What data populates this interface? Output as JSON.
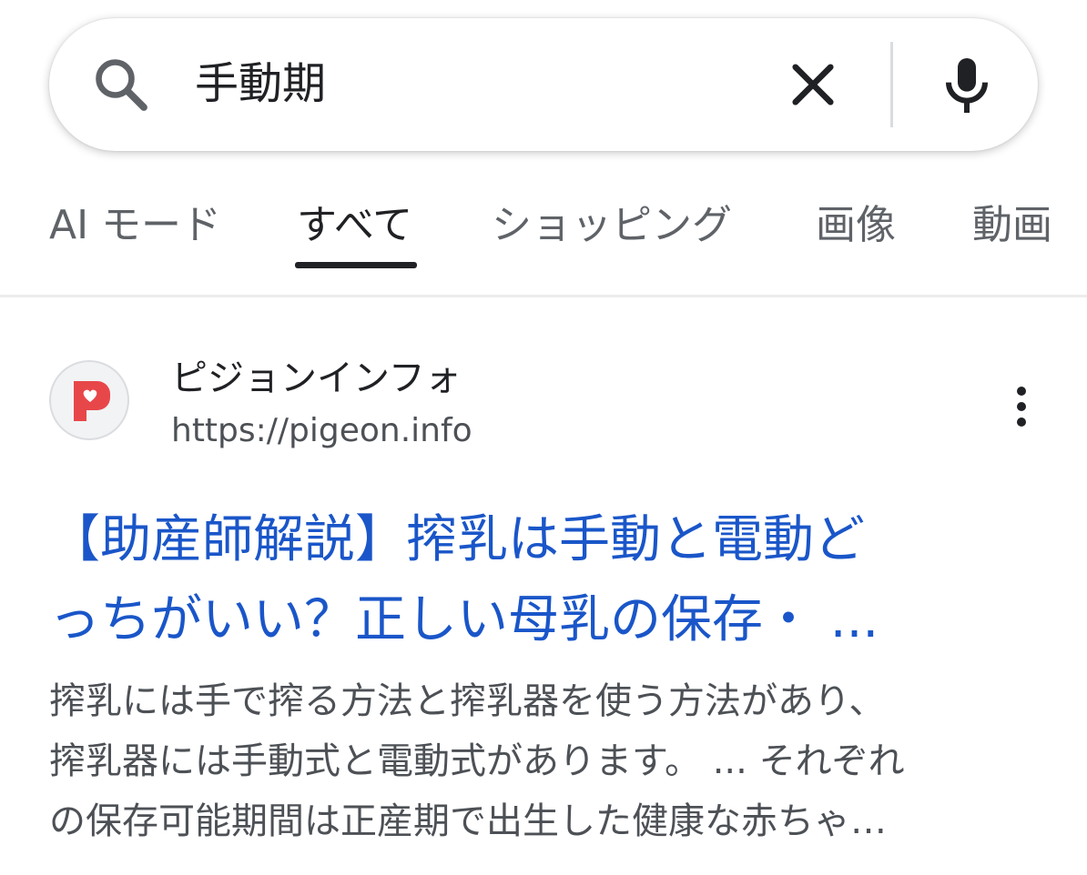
{
  "search": {
    "query": "手動期",
    "icons": {
      "search": "search-icon",
      "clear": "close-icon",
      "voice": "mic-icon"
    }
  },
  "tabs": [
    {
      "label": "AI モード",
      "active": false
    },
    {
      "label": "すべて",
      "active": true
    },
    {
      "label": "ショッピング",
      "active": false
    },
    {
      "label": "画像",
      "active": false
    },
    {
      "label": "動画",
      "active": false
    }
  ],
  "result": {
    "site_name": "ピジョンインフォ",
    "url": "https://pigeon.info",
    "favicon": "pigeon-heart-logo-icon",
    "title_lines": [
      "【助産師解説】搾乳は手動と電動ど",
      "っちがいい？正しい母乳の保存・ ..."
    ],
    "snippet_lines": [
      "搾乳には手で搾る方法と搾乳器を使う方法があり、",
      "搾乳器には手動式と電動式があります。 ... それぞれ",
      "の保存可能期間は正産期で出生した健康な赤ちゃ…"
    ]
  },
  "colors": {
    "link": "#1a56c9",
    "text": "#202124",
    "secondary": "#4d5156",
    "favicon_red": "#e8474a"
  }
}
